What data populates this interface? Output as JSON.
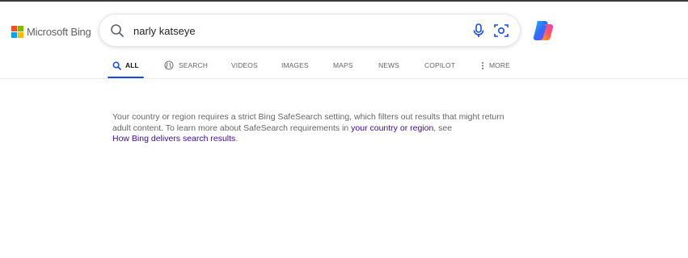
{
  "header": {
    "logo_text": "Microsoft Bing",
    "brand_colors": [
      "#f25022",
      "#7fba00",
      "#00a4ef",
      "#ffb900"
    ]
  },
  "search": {
    "query": "narly katseye",
    "icons": [
      "search-icon",
      "microphone-icon",
      "visual-search-icon"
    ]
  },
  "copilot": {
    "icon": "copilot-icon"
  },
  "nav": {
    "items": [
      {
        "label": "ALL",
        "icon": "search-icon",
        "active": true
      },
      {
        "label": "SEARCH",
        "icon": "copilot-search-icon",
        "active": false
      },
      {
        "label": "VIDEOS",
        "active": false
      },
      {
        "label": "IMAGES",
        "active": false
      },
      {
        "label": "MAPS",
        "active": false
      },
      {
        "label": "NEWS",
        "active": false
      },
      {
        "label": "COPILOT",
        "active": false
      },
      {
        "label": "MORE",
        "icon": "more-vertical-icon",
        "active": false
      }
    ],
    "accent_color": "#174ae4"
  },
  "notice": {
    "text_before_link1": "Your country or region requires a strict Bing SafeSearch setting, which filters out results that might return adult content. To learn more about SafeSearch requirements in ",
    "link1": "your country or region",
    "text_between": ", see ",
    "link2": "How Bing delivers search results",
    "text_after": ".",
    "link_color": "#4007a2"
  }
}
